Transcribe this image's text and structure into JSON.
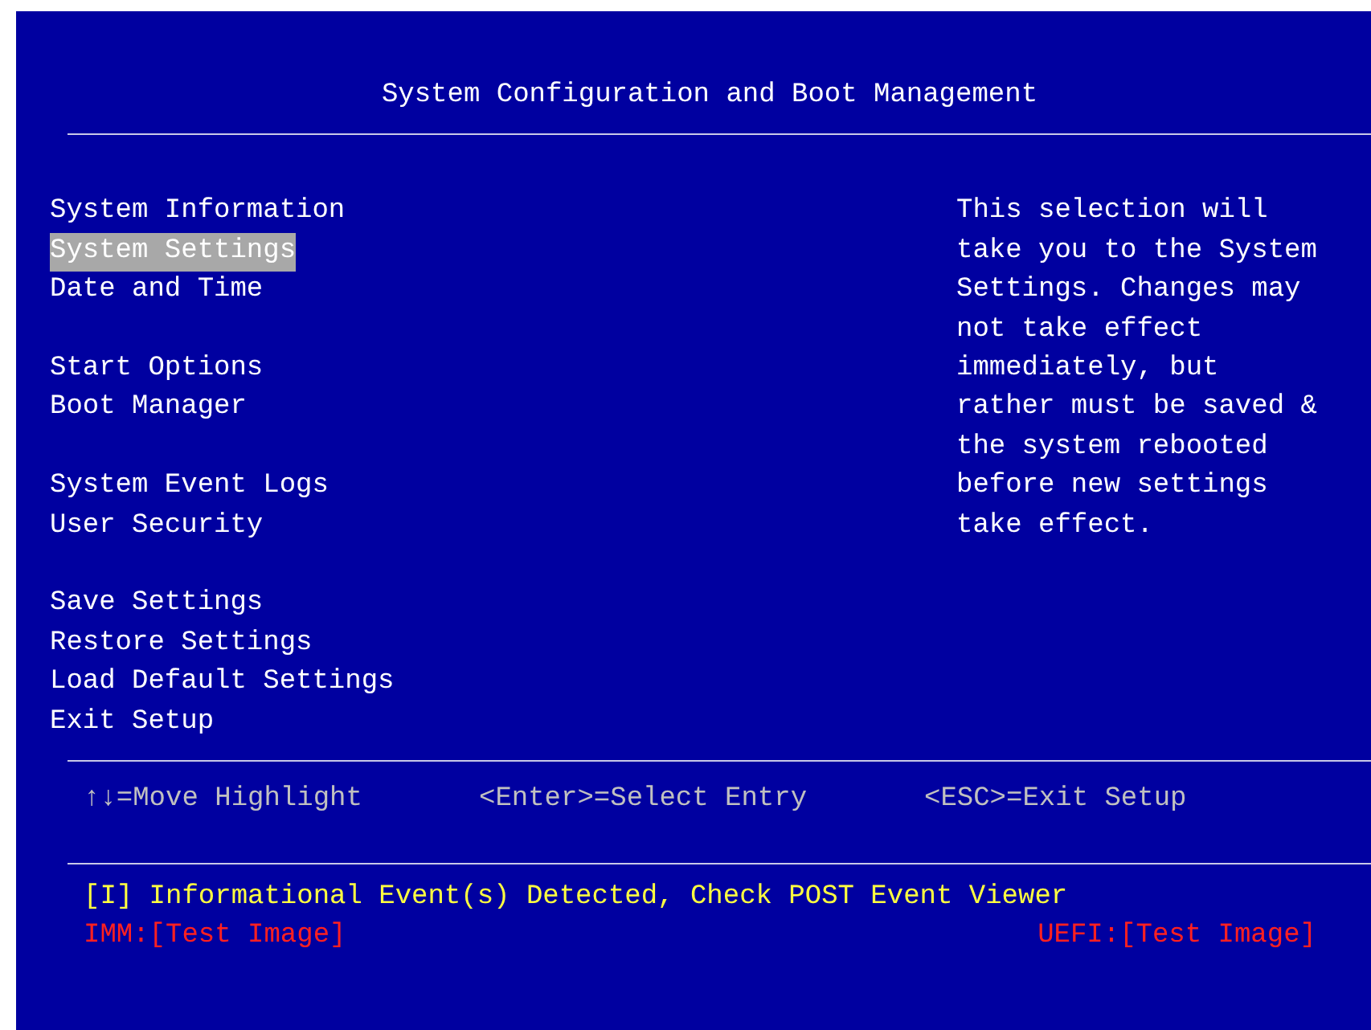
{
  "title": "System Configuration and Boot Management",
  "menu_groups": [
    [
      {
        "label": "System Information",
        "selected": false
      },
      {
        "label": "System Settings",
        "selected": true
      },
      {
        "label": "Date and Time",
        "selected": false
      }
    ],
    [
      {
        "label": "Start Options",
        "selected": false
      },
      {
        "label": "Boot Manager",
        "selected": false
      }
    ],
    [
      {
        "label": "System Event Logs",
        "selected": false
      },
      {
        "label": "User Security",
        "selected": false
      }
    ],
    [
      {
        "label": "Save Settings",
        "selected": false
      },
      {
        "label": "Restore Settings",
        "selected": false
      },
      {
        "label": "Load Default Settings",
        "selected": false
      },
      {
        "label": "Exit Setup",
        "selected": false
      }
    ]
  ],
  "help_text": "This selection will\ntake you to the System\nSettings. Changes may\nnot take effect\nimmediately, but\nrather must be saved &\nthe system rebooted\nbefore new settings\ntake effect.",
  "key_hints": [
    "↑↓=Move Highlight",
    "<Enter>=Select Entry",
    "<ESC>=Exit Setup"
  ],
  "status_message": "[I] Informational Event(s) Detected, Check POST Event Viewer",
  "imm_version": "IMM:[Test Image]",
  "uefi_version": "UEFI:[Test Image]"
}
